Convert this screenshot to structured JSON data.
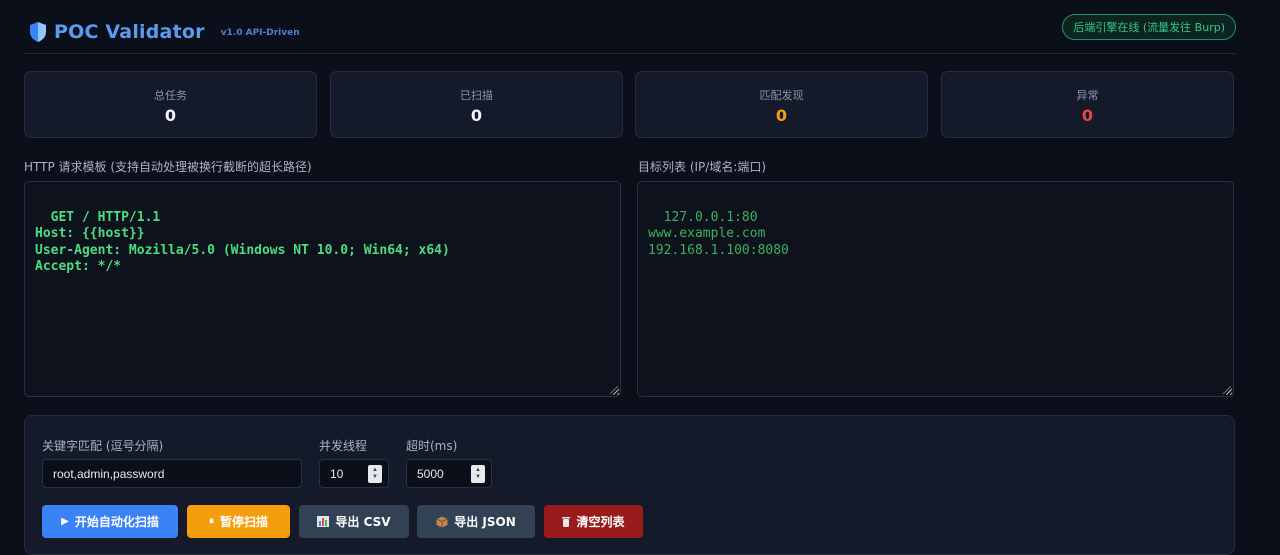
{
  "header": {
    "title": "POC Validator",
    "version": "v1.0 API-Driven",
    "status": "后端引擎在线 (流量发往 Burp)"
  },
  "stats": [
    {
      "label": "总任务",
      "value": "0",
      "color": "#f1f5f9"
    },
    {
      "label": "已扫描",
      "value": "0",
      "color": "#f1f5f9"
    },
    {
      "label": "匹配发现",
      "value": "0",
      "color": "#f59e0b"
    },
    {
      "label": "异常",
      "value": "0",
      "color": "#ef4444"
    }
  ],
  "template_panel": {
    "label": "HTTP 请求模板 (支持自动处理被换行截断的超长路径)",
    "value": "GET / HTTP/1.1\nHost: {{host}}\nUser-Agent: Mozilla/5.0 (Windows NT 10.0; Win64; x64)\nAccept: */*"
  },
  "targets_panel": {
    "label": "目标列表 (IP/域名:端口)",
    "value": "127.0.0.1:80\nwww.example.com\n192.168.1.100:8080"
  },
  "controls": {
    "keywords_label": "关键字匹配 (逗号分隔)",
    "keywords_value": "root,admin,password",
    "threads_label": "并发线程",
    "threads_value": "10",
    "timeout_label": "超时(ms)",
    "timeout_value": "5000"
  },
  "buttons": {
    "start": "开始自动化扫描",
    "pause": "暂停扫描",
    "export_csv": "导出 CSV",
    "export_json": "导出 JSON",
    "clear": "清空列表"
  },
  "icons": {
    "start": "play-icon",
    "pause": "pause-icon",
    "export_csv": "bar-chart-icon",
    "export_json": "package-icon",
    "clear": "trash-icon"
  },
  "colors": {
    "accent": "#3b82f6",
    "pause": "#f59e0b",
    "neutral": "#334155",
    "danger": "#991b1b",
    "online": "#34c58b",
    "code": "#4ade80"
  }
}
